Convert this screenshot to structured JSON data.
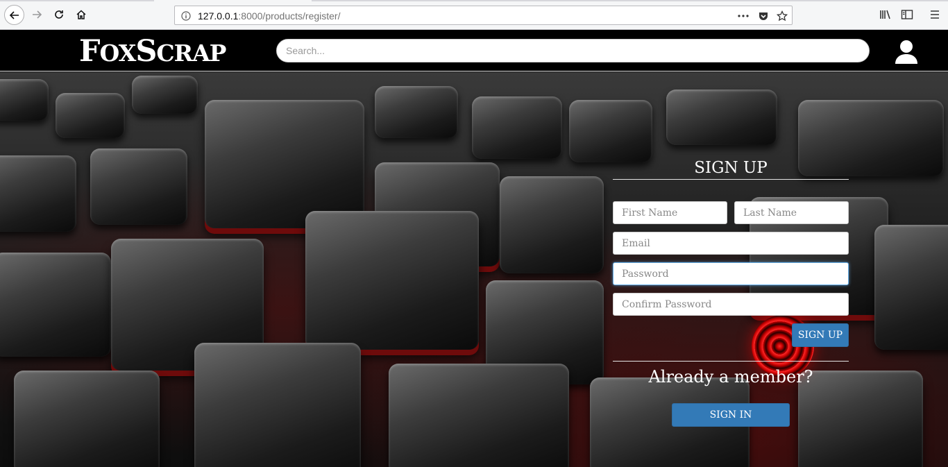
{
  "browser": {
    "url_host": "127.0.0.1",
    "url_path": ":8000/products/register/"
  },
  "header": {
    "logo_part1_big": "F",
    "logo_part1_small": "OX",
    "logo_part2_big": "S",
    "logo_part2_small": "CRAP",
    "search_placeholder": "Search..."
  },
  "signup": {
    "title": "SIGN UP",
    "first_name_placeholder": "First Name",
    "last_name_placeholder": "Last Name",
    "email_placeholder": "Email",
    "password_placeholder": "Password",
    "confirm_password_placeholder": "Confirm Password",
    "submit_label": "SIGN UP",
    "member_prompt": "Already a member?",
    "signin_label": "SIGN IN"
  },
  "colors": {
    "header_bg": "#000000",
    "button_primary": "#337ab7",
    "focus_ring": "#66afe9"
  }
}
